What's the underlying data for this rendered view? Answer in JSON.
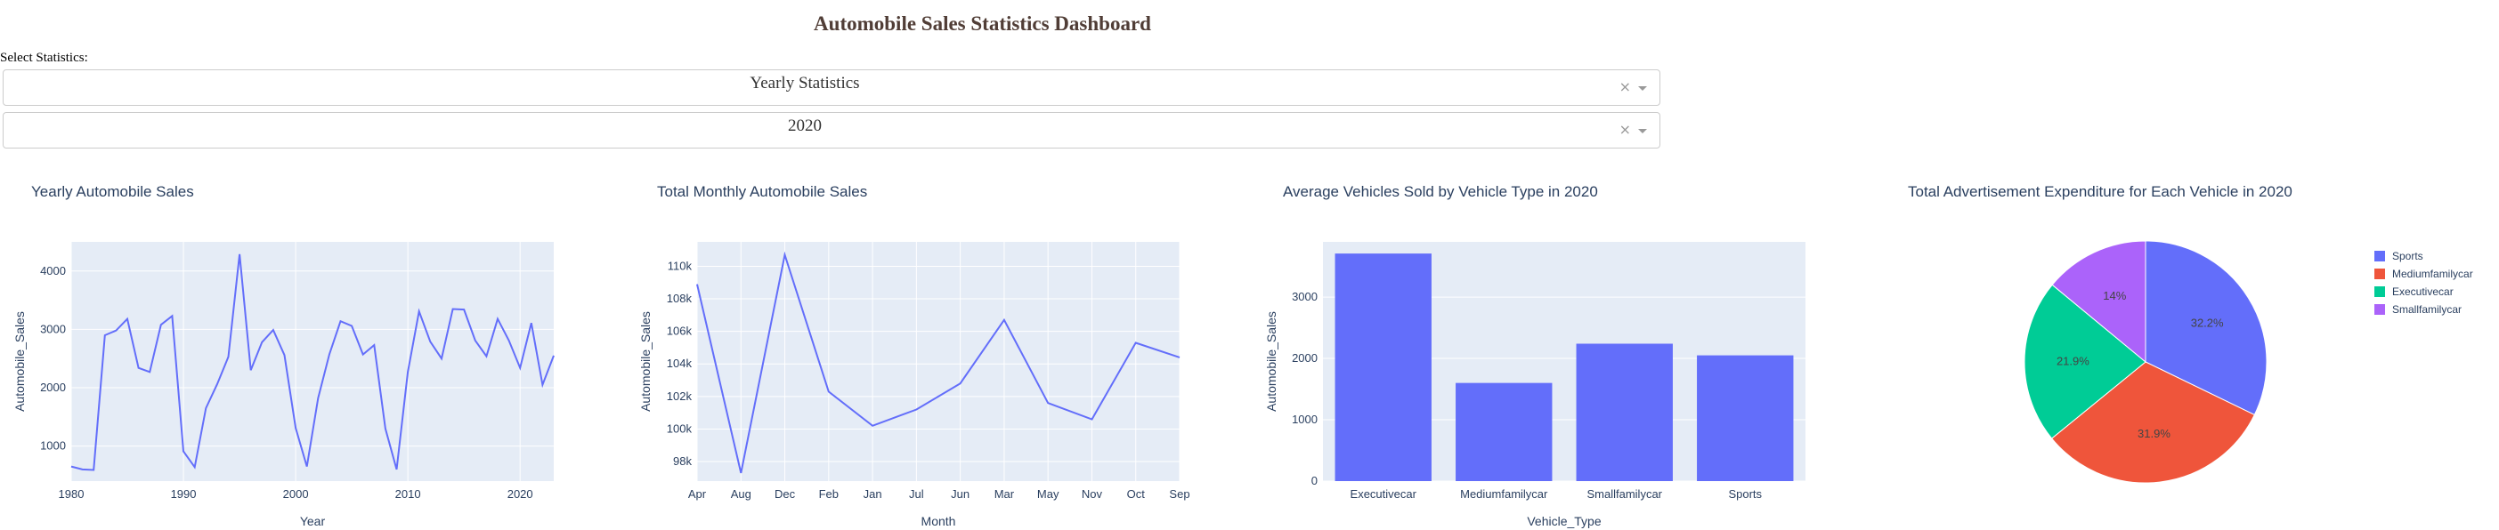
{
  "page": {
    "title": "Automobile Sales Statistics Dashboard",
    "select_label": "Select Statistics:",
    "dropdown_statistics": {
      "value": "Yearly Statistics",
      "clear": "×"
    },
    "dropdown_year": {
      "value": "2020",
      "clear": "×"
    }
  },
  "colors": {
    "title": "#503D36",
    "plot_bg": "#E5ECF6",
    "grid": "#ffffff",
    "axis_text": "#2a3f5f",
    "series": "#636EFA",
    "pie": [
      "#636EFA",
      "#EF553B",
      "#00CC96",
      "#AB63FA"
    ]
  },
  "chart_data": [
    {
      "type": "line",
      "title": "Yearly Automobile Sales",
      "xlabel": "Year",
      "ylabel": "Automobile_Sales",
      "x": [
        1980,
        1981,
        1982,
        1983,
        1984,
        1985,
        1986,
        1987,
        1988,
        1989,
        1990,
        1991,
        1992,
        1993,
        1994,
        1995,
        1996,
        1997,
        1998,
        1999,
        2000,
        2001,
        2002,
        2003,
        2004,
        2005,
        2006,
        2007,
        2008,
        2009,
        2010,
        2011,
        2012,
        2013,
        2014,
        2015,
        2016,
        2017,
        2018,
        2019,
        2020,
        2021,
        2022,
        2023
      ],
      "y": [
        650,
        600,
        590,
        2900,
        2980,
        3180,
        2340,
        2270,
        3080,
        3230,
        910,
        640,
        1650,
        2060,
        2530,
        4290,
        2300,
        2780,
        2990,
        2560,
        1310,
        650,
        1820,
        2570,
        3140,
        3060,
        2570,
        2730,
        1300,
        600,
        2270,
        3310,
        2790,
        2500,
        3350,
        3340,
        2810,
        2540,
        3180,
        2810,
        2340,
        3110,
        2050,
        2550
      ],
      "xlim": [
        1980,
        2023
      ],
      "ylim": [
        400,
        4500
      ],
      "xticks": [
        1980,
        1990,
        2000,
        2010,
        2020
      ],
      "yticks": [
        1000,
        2000,
        3000,
        4000
      ]
    },
    {
      "type": "line",
      "title": "Total Monthly Automobile Sales",
      "xlabel": "Month",
      "ylabel": "Automobile_Sales",
      "categories": [
        "Apr",
        "Aug",
        "Dec",
        "Feb",
        "Jan",
        "Jul",
        "Jun",
        "Mar",
        "May",
        "Nov",
        "Oct",
        "Sep"
      ],
      "values": [
        108900,
        97300,
        110700,
        102300,
        100200,
        101200,
        102800,
        106700,
        101600,
        100600,
        105300,
        104400
      ],
      "ylim": [
        96800,
        111500
      ],
      "yticks": [
        98000,
        100000,
        102000,
        104000,
        106000,
        108000,
        110000
      ],
      "ytick_labels": [
        "98k",
        "100k",
        "102k",
        "104k",
        "106k",
        "108k",
        "110k"
      ]
    },
    {
      "type": "bar",
      "title": "Average Vehicles Sold by Vehicle Type in 2020",
      "xlabel": "Vehicle_Type",
      "ylabel": "Automobile_Sales",
      "categories": [
        "Executivecar",
        "Mediumfamilycar",
        "Smallfamilycar",
        "Sports"
      ],
      "values": [
        3710,
        1600,
        2240,
        2050
      ],
      "ylim": [
        0,
        3900
      ],
      "yticks": [
        0,
        1000,
        2000,
        3000
      ]
    },
    {
      "type": "pie",
      "title": "Total Advertisement Expenditure for Each Vehicle in 2020",
      "labels": [
        "Sports",
        "Mediumfamilycar",
        "Executivecar",
        "Smallfamilycar"
      ],
      "values": [
        32.2,
        31.9,
        21.9,
        14.0
      ],
      "value_labels": [
        "32.2%",
        "31.9%",
        "21.9%",
        "14%"
      ],
      "legend": "right"
    }
  ]
}
